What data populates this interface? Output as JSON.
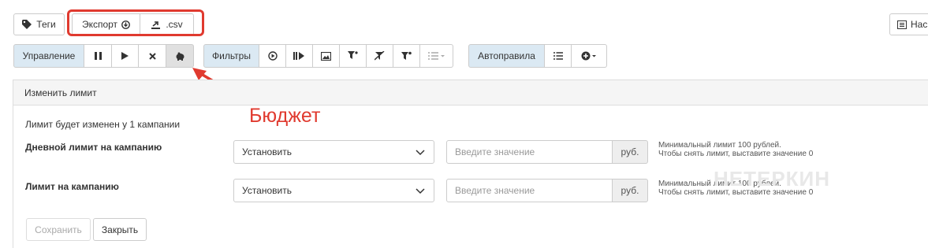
{
  "toolbar_top": {
    "tags_label": "Теги",
    "export_label": "Экспорт",
    "csv_label": ".csv",
    "right_label": "Нас"
  },
  "toolbar_manage": {
    "group_label": "Управление",
    "icons": [
      "pause-icon",
      "play-icon",
      "close-icon",
      "piggy-bank-icon"
    ]
  },
  "toolbar_filters": {
    "group_label": "Фильтры",
    "icons": [
      "play-circle-icon",
      "play-next-icon",
      "image-icon",
      "filter-icon",
      "filter-clear-icon",
      "filter-settings-icon",
      "list-dropdown-icon"
    ]
  },
  "toolbar_autorules": {
    "group_label": "Автоправила",
    "icons": [
      "list-icon",
      "add-circle-dropdown-icon"
    ]
  },
  "annotation": {
    "label": "Бюджет",
    "color": "#e03a2f"
  },
  "panel": {
    "title": "Изменить лимит",
    "info": "Лимит будет изменен у 1 кампании",
    "rows": [
      {
        "label": "Дневной лимит на кампанию",
        "select_value": "Установить",
        "input_placeholder": "Введите значение",
        "addon": "руб.",
        "hint_line1": "Минимальный лимит 100 рублей.",
        "hint_line2": "Чтобы снять лимит, выставите значение 0"
      },
      {
        "label": "Лимит на кампанию",
        "select_value": "Установить",
        "input_placeholder": "Введите значение",
        "addon": "руб.",
        "hint_line1": "Минимальный лимит 100 рублей.",
        "hint_line2": "Чтобы снять лимит, выставите значение 0"
      }
    ],
    "save_label": "Сохранить",
    "close_label": "Закрыть"
  },
  "watermark": "НЕТЕРКИН",
  "colors": {
    "label_bg": "#dbe9f3",
    "active_bg": "#e0e0e0",
    "annotation": "#e03a2f"
  }
}
